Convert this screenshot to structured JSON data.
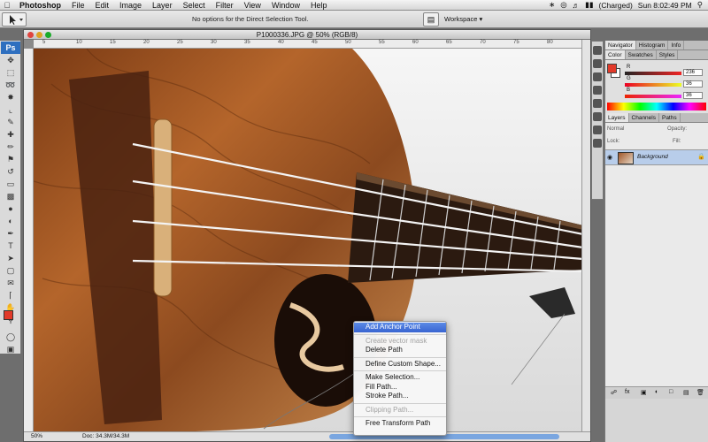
{
  "menubar": {
    "app": "Photoshop",
    "items": [
      "File",
      "Edit",
      "Image",
      "Layer",
      "Select",
      "Filter",
      "View",
      "Window",
      "Help"
    ],
    "status_right": "(Charged)",
    "clock": "Sun 8:02:49 PM"
  },
  "options": {
    "info": "No options for the Direct Selection Tool.",
    "workspace": "Workspace"
  },
  "toolbox": {
    "badge": "Ps",
    "fg_color": "#e23a2a"
  },
  "document": {
    "title": "P1000336.JPG @ 50% (RGB/8)",
    "ruler_labels": [
      "5",
      "10",
      "15",
      "20",
      "25",
      "30",
      "35",
      "40",
      "45",
      "50",
      "55",
      "60",
      "65",
      "70",
      "75",
      "80"
    ],
    "zoom": "50%",
    "doc_size": "Doc: 34.3M/34.3M"
  },
  "panels": {
    "top_tabs": [
      "Navigator",
      "Histogram",
      "Info"
    ],
    "color_tabs": [
      "Color",
      "Swatches",
      "Styles"
    ],
    "color": {
      "r_label": "R",
      "g_label": "G",
      "b_label": "B",
      "r": "236",
      "g": "36",
      "b": "36"
    },
    "layers_tabs": [
      "Layers",
      "Channels",
      "Paths"
    ],
    "blend_mode": "Normal",
    "opacity_label": "Opacity:",
    "lock_label": "Lock:",
    "fill_label": "Fill:",
    "layer_name": "Background"
  },
  "context_menu": {
    "items": [
      {
        "label": "Add Anchor Point",
        "state": "highlighted"
      },
      {
        "sep": true
      },
      {
        "label": "Create vector mask",
        "state": "disabled"
      },
      {
        "label": "Delete Path",
        "state": "normal"
      },
      {
        "sep": true
      },
      {
        "label": "Define Custom Shape...",
        "state": "normal"
      },
      {
        "sep": true
      },
      {
        "label": "Make Selection...",
        "state": "normal"
      },
      {
        "label": "Fill Path...",
        "state": "normal"
      },
      {
        "label": "Stroke Path...",
        "state": "normal"
      },
      {
        "sep": true
      },
      {
        "label": "Clipping Path...",
        "state": "disabled"
      },
      {
        "sep": true
      },
      {
        "label": "Free Transform Path",
        "state": "normal"
      }
    ]
  }
}
